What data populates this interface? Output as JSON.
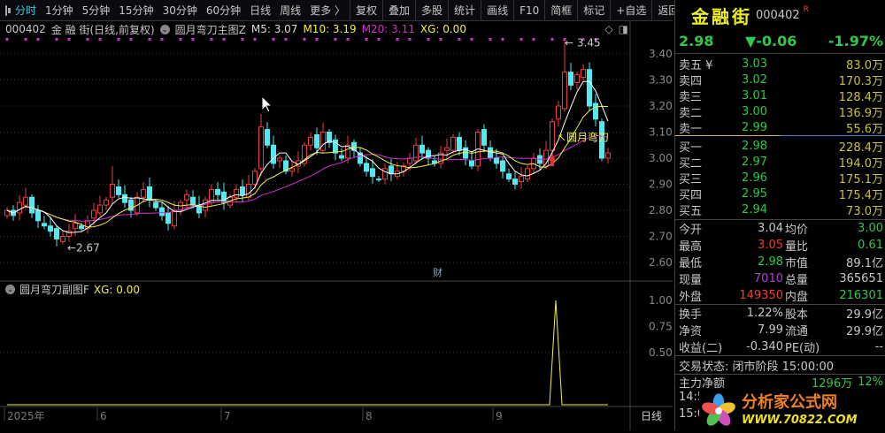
{
  "toolbar": {
    "tabs": [
      "分时",
      "1分钟",
      "5分钟",
      "15分钟",
      "30分钟",
      "60分钟",
      "日线",
      "周线",
      "更多 〉"
    ],
    "active": 0,
    "buttons": [
      "复权",
      "叠加",
      "多股",
      "统计",
      "画线",
      "F10",
      "简框",
      "标记",
      "+自选",
      "返回"
    ]
  },
  "info": {
    "code": "000402",
    "name": "金 融 街",
    "period": "(日线,前复权)",
    "indicator": "圆月弯刀主图Z",
    "m5": "M5: 3.07",
    "m10": "M10: 3.19",
    "m20": "M20: 3.11",
    "xg": "XG: 0.00"
  },
  "sub": {
    "indicator": "圆月弯刀副图F",
    "xg": "XG: 0.00",
    "ticks": [
      "1.00",
      "0.75",
      "0.50"
    ]
  },
  "chart_data": {
    "type": "candlestick",
    "ylim": [
      2.55,
      3.48
    ],
    "yticks": [
      "3.40",
      "3.30",
      "3.20",
      "3.10",
      "3.00",
      "2.90",
      "2.80",
      "2.70",
      "2.60"
    ],
    "closes": [
      2.8,
      2.78,
      2.83,
      2.85,
      2.79,
      2.76,
      2.74,
      2.72,
      2.69,
      2.7,
      2.72,
      2.75,
      2.73,
      2.76,
      2.8,
      2.82,
      2.84,
      2.9,
      2.86,
      2.83,
      2.8,
      2.85,
      2.88,
      2.84,
      2.81,
      2.78,
      2.75,
      2.8,
      2.83,
      2.86,
      2.82,
      2.79,
      2.84,
      2.88,
      2.86,
      2.83,
      2.85,
      2.88,
      2.86,
      2.9,
      2.95,
      3.12,
      3.05,
      2.98,
      3.0,
      2.95,
      2.96,
      2.99,
      3.05,
      3.08,
      3.04,
      3.1,
      3.06,
      3.02,
      3.0,
      3.05,
      3.03,
      2.98,
      2.95,
      2.93,
      2.92,
      2.96,
      2.94,
      2.95,
      2.97,
      3.0,
      3.05,
      3.02,
      3.0,
      2.98,
      3.02,
      3.04,
      3.08,
      3.03,
      3.0,
      2.97,
      3.1,
      3.05,
      3.0,
      2.98,
      2.95,
      2.92,
      2.9,
      2.93,
      2.96,
      3.0,
      2.98,
      3.03,
      3.14,
      3.2,
      3.33,
      3.28,
      3.32,
      3.34,
      3.2,
      3.15,
      3.0,
      3.02
    ],
    "high_label": "3.45",
    "low_label": "2.67",
    "signal_label": "圆月弯刀",
    "signal_index": 88,
    "x_labels": [
      "2025年",
      "6",
      "7",
      "8",
      "9"
    ],
    "period_label": "日线",
    "marker": "财",
    "ma_colors": {
      "m5": "#ffffff",
      "m10": "#f0f040",
      "m20": "#d030d0"
    },
    "up_color": "#f03c3c",
    "down_color": "#54e8f0"
  },
  "quote": {
    "name": "金融街",
    "code": "000402",
    "flag": "R",
    "price": "2.98",
    "change": "▼-0.06",
    "pct": "-1.97%",
    "asks": [
      [
        "卖五 ¥",
        "3.03",
        "83.0万"
      ],
      [
        "卖四",
        "3.02",
        "170.3万"
      ],
      [
        "卖三",
        "3.01",
        "128.4万"
      ],
      [
        "卖二",
        "3.00",
        "136.9万"
      ],
      [
        "卖一",
        "2.99",
        "55.6万"
      ]
    ],
    "bids": [
      [
        "买一",
        "2.98",
        "228.4万"
      ],
      [
        "买二",
        "2.97",
        "194.0万"
      ],
      [
        "买三",
        "2.96",
        "175.1万"
      ],
      [
        "买四",
        "2.95",
        "175.4万"
      ],
      [
        "买五",
        "2.94",
        "73.0万"
      ]
    ],
    "stats": [
      [
        "今开",
        "3.04",
        "均价",
        "3.00"
      ],
      [
        "最高",
        "3.05",
        "量比",
        "0.61"
      ],
      [
        "最低",
        "2.98",
        "市值",
        "89.1亿"
      ],
      [
        "现量",
        "7010",
        "总量",
        "365651"
      ],
      [
        "外盘",
        "149350",
        "内盘",
        "216301"
      ]
    ],
    "stats2": [
      [
        "换手",
        "1.22%",
        "股本",
        "29.9亿"
      ],
      [
        "净资",
        "7.99",
        "流通",
        "29.9亿"
      ],
      [
        "收益(二)",
        "-0.340",
        "PE(动)",
        "--"
      ]
    ],
    "status": "交易状态: 闭市阶段 15:00:00",
    "flow_label": "主力净额",
    "flow_val": "1296万",
    "flow_pct": "12%",
    "times": [
      "14:5",
      "15:0"
    ]
  },
  "watermark": {
    "title": "分析家公式网",
    "url": "WWW.70822.COM"
  }
}
